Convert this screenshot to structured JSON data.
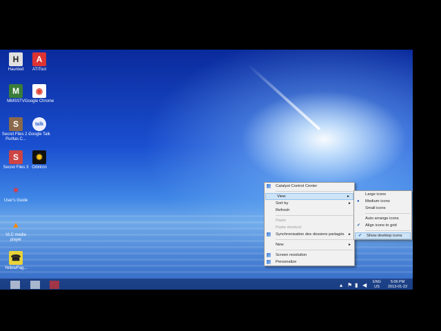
{
  "desktop_icons": [
    {
      "label": "Haunted",
      "glyph": "H",
      "color": "#e0e0e0",
      "fg": "#222"
    },
    {
      "label": "ATITool",
      "glyph": "A",
      "color": "#d33",
      "fg": "#fff"
    },
    {
      "label": "MMSSTV",
      "glyph": "M",
      "color": "#3a7d3a",
      "fg": "#fff"
    },
    {
      "label": "Google Chrome",
      "glyph": "◉",
      "color": "#ffffff",
      "fg": "#db4437"
    },
    {
      "label": "Secret Files 2 - Puritas C...",
      "glyph": "S",
      "color": "#8a6a4a",
      "fg": "#fff"
    },
    {
      "label": "Google Talk",
      "glyph": "talk",
      "color": "#eef",
      "fg": "#2a62c9"
    },
    {
      "label": "Secret Files 3",
      "glyph": "S",
      "color": "#c44",
      "fg": "#fff"
    },
    {
      "label": "Orbitron",
      "glyph": "✹",
      "color": "#111",
      "fg": "#f6c21a"
    },
    {
      "label": "User's Guide",
      "glyph": "✶",
      "color": "transparent",
      "fg": "#e33"
    },
    {
      "label": "VLC media player",
      "glyph": "▲",
      "color": "transparent",
      "fg": "#f80"
    },
    {
      "label": "YellowPag...",
      "glyph": "☎",
      "color": "#e8d23a",
      "fg": "#222"
    }
  ],
  "context_menu": {
    "items": [
      {
        "label": "Catalyst Control Center",
        "icon": true
      },
      {
        "sep": true
      },
      {
        "label": "View",
        "submenu": true,
        "highlight": true
      },
      {
        "label": "Sort by",
        "submenu": true
      },
      {
        "label": "Refresh"
      },
      {
        "sep": true
      },
      {
        "label": "Paste",
        "disabled": true
      },
      {
        "label": "Paste shortcut",
        "disabled": true
      },
      {
        "label": "Synchronisation des dossiers partagés",
        "submenu": true,
        "icon": true
      },
      {
        "sep": true
      },
      {
        "label": "New",
        "submenu": true
      },
      {
        "sep": true
      },
      {
        "label": "Screen resolution",
        "icon": true
      },
      {
        "label": "Personalize",
        "icon": true
      }
    ]
  },
  "view_submenu": {
    "items": [
      {
        "label": "Large icons"
      },
      {
        "label": "Medium icons",
        "mark": "●"
      },
      {
        "label": "Small icons"
      },
      {
        "sep": true
      },
      {
        "label": "Auto arrange icons"
      },
      {
        "label": "Align icons to grid",
        "mark": "✔"
      },
      {
        "sep": true
      },
      {
        "label": "Show desktop icons",
        "mark": "✔",
        "highlight": true
      }
    ]
  },
  "taskbar": {
    "language": "ENG",
    "language_sub": "US",
    "time": "5:06 PM",
    "date": "2013-01-22"
  }
}
